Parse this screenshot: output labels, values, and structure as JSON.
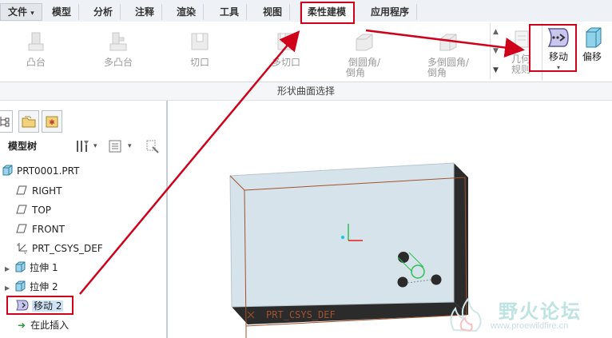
{
  "tabs": {
    "file": "文件",
    "items": [
      "模型",
      "分析",
      "注释",
      "渲染",
      "工具",
      "视图",
      "柔性建模",
      "应用程序"
    ],
    "active": "柔性建模"
  },
  "ribbon": {
    "buttons": [
      "凸台",
      "多凸台",
      "切口",
      "多切口"
    ],
    "round_line1": "倒圆角/",
    "round_line2": "倒角",
    "multi_round_line1": "多倒圆角/",
    "multi_round_line2": "倒角",
    "geom_rule_line1": "几何",
    "geom_rule_line2": "规则",
    "move": "移动",
    "offset": "偏移",
    "group_label": "形状曲面选择"
  },
  "model_tree": {
    "title": "模型树",
    "items": [
      {
        "label": "PRT0001.PRT",
        "icon": "part-icon"
      },
      {
        "label": "RIGHT",
        "icon": "datum-plane-icon"
      },
      {
        "label": "TOP",
        "icon": "datum-plane-icon"
      },
      {
        "label": "FRONT",
        "icon": "datum-plane-icon"
      },
      {
        "label": "PRT_CSYS_DEF",
        "icon": "csys-icon"
      },
      {
        "label": "拉伸 1",
        "icon": "extrude-icon"
      },
      {
        "label": "拉伸 2",
        "icon": "extrude-icon"
      },
      {
        "label": "移动 2",
        "icon": "move-feature-icon"
      },
      {
        "label": "在此插入",
        "icon": "insert-here-arrow-icon"
      }
    ]
  },
  "viewport": {
    "csys_label": "PRT_CSYS_DEF"
  },
  "watermark": {
    "title": "野火论坛",
    "url": "www.proewildfire.cn"
  },
  "colors": {
    "annotation_red": "#d0021b",
    "part_face": "#d7e3ea",
    "part_side": "#2b2b2b",
    "datum_edge": "#a0522d"
  }
}
